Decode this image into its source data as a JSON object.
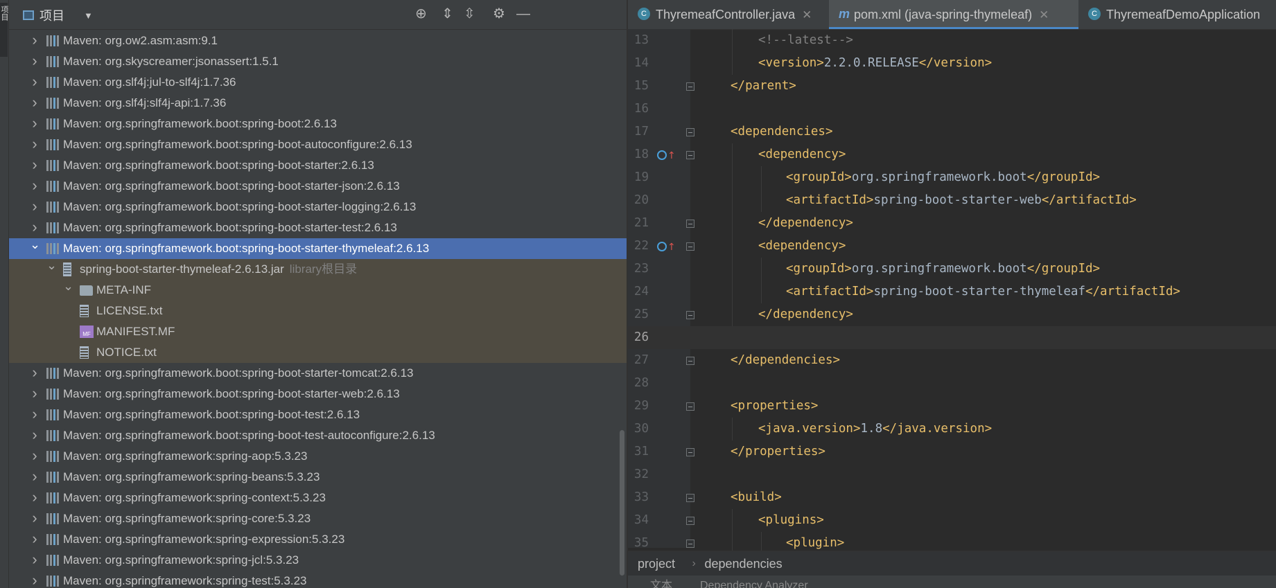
{
  "side_stripe": {
    "label": "项目"
  },
  "project_panel": {
    "title": "项目",
    "toolbar": [
      "locate-icon",
      "expand-all-icon",
      "collapse-all-icon",
      "gear-icon",
      "minimize-icon"
    ],
    "tree": [
      {
        "label": "Maven: org.ow2.asm:asm:9.1",
        "depth": 0,
        "expanded": false,
        "icon": "library",
        "state": "normal"
      },
      {
        "label": "Maven: org.skyscreamer:jsonassert:1.5.1",
        "depth": 0,
        "expanded": false,
        "icon": "library",
        "state": "normal"
      },
      {
        "label": "Maven: org.slf4j:jul-to-slf4j:1.7.36",
        "depth": 0,
        "expanded": false,
        "icon": "library",
        "state": "normal"
      },
      {
        "label": "Maven: org.slf4j:slf4j-api:1.7.36",
        "depth": 0,
        "expanded": false,
        "icon": "library",
        "state": "normal"
      },
      {
        "label": "Maven: org.springframework.boot:spring-boot:2.6.13",
        "depth": 0,
        "expanded": false,
        "icon": "library",
        "state": "normal"
      },
      {
        "label": "Maven: org.springframework.boot:spring-boot-autoconfigure:2.6.13",
        "depth": 0,
        "expanded": false,
        "icon": "library",
        "state": "normal"
      },
      {
        "label": "Maven: org.springframework.boot:spring-boot-starter:2.6.13",
        "depth": 0,
        "expanded": false,
        "icon": "library",
        "state": "normal"
      },
      {
        "label": "Maven: org.springframework.boot:spring-boot-starter-json:2.6.13",
        "depth": 0,
        "expanded": false,
        "icon": "library",
        "state": "normal"
      },
      {
        "label": "Maven: org.springframework.boot:spring-boot-starter-logging:2.6.13",
        "depth": 0,
        "expanded": false,
        "icon": "library",
        "state": "normal"
      },
      {
        "label": "Maven: org.springframework.boot:spring-boot-starter-test:2.6.13",
        "depth": 0,
        "expanded": false,
        "icon": "library",
        "state": "normal"
      },
      {
        "label": "Maven: org.springframework.boot:spring-boot-starter-thymeleaf:2.6.13",
        "depth": 0,
        "expanded": true,
        "icon": "library",
        "state": "selected"
      },
      {
        "label": "spring-boot-starter-thymeleaf-2.6.13.jar",
        "hint": "library根目录",
        "depth": 1,
        "expanded": true,
        "icon": "jar",
        "state": "lib"
      },
      {
        "label": "META-INF",
        "depth": 2,
        "expanded": true,
        "icon": "folder",
        "state": "lib"
      },
      {
        "label": "LICENSE.txt",
        "depth": 3,
        "expanded": null,
        "icon": "text",
        "state": "lib"
      },
      {
        "label": "MANIFEST.MF",
        "depth": 3,
        "expanded": null,
        "icon": "manifest",
        "state": "lib"
      },
      {
        "label": "NOTICE.txt",
        "depth": 3,
        "expanded": null,
        "icon": "text",
        "state": "lib"
      },
      {
        "label": "Maven: org.springframework.boot:spring-boot-starter-tomcat:2.6.13",
        "depth": 0,
        "expanded": false,
        "icon": "library",
        "state": "normal"
      },
      {
        "label": "Maven: org.springframework.boot:spring-boot-starter-web:2.6.13",
        "depth": 0,
        "expanded": false,
        "icon": "library",
        "state": "normal"
      },
      {
        "label": "Maven: org.springframework.boot:spring-boot-test:2.6.13",
        "depth": 0,
        "expanded": false,
        "icon": "library",
        "state": "normal"
      },
      {
        "label": "Maven: org.springframework.boot:spring-boot-test-autoconfigure:2.6.13",
        "depth": 0,
        "expanded": false,
        "icon": "library",
        "state": "normal"
      },
      {
        "label": "Maven: org.springframework:spring-aop:5.3.23",
        "depth": 0,
        "expanded": false,
        "icon": "library",
        "state": "normal"
      },
      {
        "label": "Maven: org.springframework:spring-beans:5.3.23",
        "depth": 0,
        "expanded": false,
        "icon": "library",
        "state": "normal"
      },
      {
        "label": "Maven: org.springframework:spring-context:5.3.23",
        "depth": 0,
        "expanded": false,
        "icon": "library",
        "state": "normal"
      },
      {
        "label": "Maven: org.springframework:spring-core:5.3.23",
        "depth": 0,
        "expanded": false,
        "icon": "library",
        "state": "normal"
      },
      {
        "label": "Maven: org.springframework:spring-expression:5.3.23",
        "depth": 0,
        "expanded": false,
        "icon": "library",
        "state": "normal"
      },
      {
        "label": "Maven: org.springframework:spring-jcl:5.3.23",
        "depth": 0,
        "expanded": false,
        "icon": "library",
        "state": "normal"
      },
      {
        "label": "Maven: org.springframework:spring-test:5.3.23",
        "depth": 0,
        "expanded": false,
        "icon": "library",
        "state": "normal"
      }
    ]
  },
  "editor": {
    "tabs": [
      {
        "label": "ThyremeafController.java",
        "icon": "class-icon",
        "active": false,
        "closable": true
      },
      {
        "label": "pom.xml (java-spring-thymeleaf)",
        "icon": "maven-icon",
        "active": true,
        "closable": true
      },
      {
        "label": "ThyremeafDemoApplication",
        "icon": "app-icon",
        "active": false,
        "closable": false
      }
    ],
    "lines": [
      {
        "n": "13",
        "indent": 2,
        "parts": [
          [
            "cm",
            "<!--latest-->"
          ]
        ],
        "fold": false,
        "mark": false
      },
      {
        "n": "14",
        "indent": 2,
        "parts": [
          [
            "tg",
            "<version>"
          ],
          [
            "tx",
            "2.2.0.RELEASE"
          ],
          [
            "tg",
            "</version>"
          ]
        ],
        "fold": false,
        "mark": false
      },
      {
        "n": "15",
        "indent": 1,
        "parts": [
          [
            "tg",
            "</parent>"
          ]
        ],
        "fold": true,
        "mark": false
      },
      {
        "n": "16",
        "indent": 0,
        "parts": [],
        "fold": false,
        "mark": false
      },
      {
        "n": "17",
        "indent": 1,
        "parts": [
          [
            "tg",
            "<dependencies>"
          ]
        ],
        "fold": true,
        "mark": false
      },
      {
        "n": "18",
        "indent": 2,
        "parts": [
          [
            "tg",
            "<dependency>"
          ]
        ],
        "fold": true,
        "mark": true
      },
      {
        "n": "19",
        "indent": 3,
        "parts": [
          [
            "tg",
            "<groupId>"
          ],
          [
            "tx",
            "org.springframework.boot"
          ],
          [
            "tg",
            "</groupId>"
          ]
        ],
        "fold": false,
        "mark": false
      },
      {
        "n": "20",
        "indent": 3,
        "parts": [
          [
            "tg",
            "<artifactId>"
          ],
          [
            "tx",
            "spring-boot-starter-web"
          ],
          [
            "tg",
            "</artifactId>"
          ]
        ],
        "fold": false,
        "mark": false
      },
      {
        "n": "21",
        "indent": 2,
        "parts": [
          [
            "tg",
            "</dependency>"
          ]
        ],
        "fold": true,
        "mark": false
      },
      {
        "n": "22",
        "indent": 2,
        "parts": [
          [
            "tg",
            "<dependency>"
          ]
        ],
        "fold": true,
        "mark": true
      },
      {
        "n": "23",
        "indent": 3,
        "parts": [
          [
            "tg",
            "<groupId>"
          ],
          [
            "tx",
            "org.springframework.boot"
          ],
          [
            "tg",
            "</groupId>"
          ]
        ],
        "fold": false,
        "mark": false
      },
      {
        "n": "24",
        "indent": 3,
        "parts": [
          [
            "tg",
            "<artifactId>"
          ],
          [
            "tx",
            "spring-boot-starter-thymeleaf"
          ],
          [
            "tg",
            "</artifactId>"
          ]
        ],
        "fold": false,
        "mark": false
      },
      {
        "n": "25",
        "indent": 2,
        "parts": [
          [
            "tg",
            "</dependency>"
          ]
        ],
        "fold": true,
        "mark": false
      },
      {
        "n": "26",
        "indent": 0,
        "parts": [],
        "fold": false,
        "mark": false,
        "current": true
      },
      {
        "n": "27",
        "indent": 1,
        "parts": [
          [
            "tg",
            "</dependencies>"
          ]
        ],
        "fold": true,
        "mark": false
      },
      {
        "n": "28",
        "indent": 0,
        "parts": [],
        "fold": false,
        "mark": false
      },
      {
        "n": "29",
        "indent": 1,
        "parts": [
          [
            "tg",
            "<properties>"
          ]
        ],
        "fold": true,
        "mark": false
      },
      {
        "n": "30",
        "indent": 2,
        "parts": [
          [
            "tg",
            "<java.version>"
          ],
          [
            "tx",
            "1.8"
          ],
          [
            "tg",
            "</java.version>"
          ]
        ],
        "fold": false,
        "mark": false
      },
      {
        "n": "31",
        "indent": 1,
        "parts": [
          [
            "tg",
            "</properties>"
          ]
        ],
        "fold": true,
        "mark": false
      },
      {
        "n": "32",
        "indent": 0,
        "parts": [],
        "fold": false,
        "mark": false
      },
      {
        "n": "33",
        "indent": 1,
        "parts": [
          [
            "tg",
            "<build>"
          ]
        ],
        "fold": true,
        "mark": false
      },
      {
        "n": "34",
        "indent": 2,
        "parts": [
          [
            "tg",
            "<plugins>"
          ]
        ],
        "fold": true,
        "mark": false
      },
      {
        "n": "35",
        "indent": 3,
        "parts": [
          [
            "tg",
            "<plugin>"
          ]
        ],
        "fold": true,
        "mark": false
      }
    ],
    "breadcrumb": [
      "project",
      "dependencies"
    ],
    "bottom_tabs": [
      "文本",
      "Dependency Analyzer"
    ]
  },
  "colors": {
    "selection": "#4b6eaf",
    "library_bg": "#4f4b41",
    "xml_tag": "#e8bf6a",
    "xml_text": "#a9b7c6",
    "comment": "#808080",
    "accent": "#4a88c7"
  }
}
